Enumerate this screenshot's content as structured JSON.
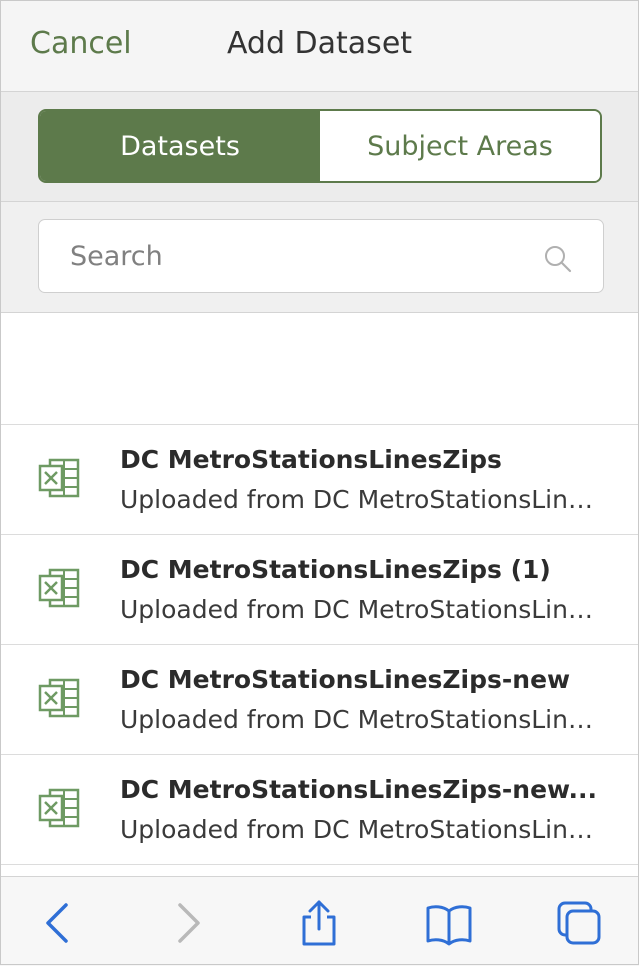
{
  "header": {
    "cancel_label": "Cancel",
    "title": "Add Dataset"
  },
  "segments": {
    "datasets_label": "Datasets",
    "subject_areas_label": "Subject Areas",
    "active": "Datasets"
  },
  "search": {
    "placeholder": "Search",
    "value": "",
    "icon": "search-icon"
  },
  "datasets": [
    {
      "name": "DC MetroStationsLinesZips",
      "description": "Uploaded from DC MetroStationsLinesZips.xlsx",
      "icon": "excel-file-icon"
    },
    {
      "name": "DC MetroStationsLinesZips (1)",
      "description": "Uploaded from DC MetroStationsLinesZips.xlsx",
      "icon": "excel-file-icon"
    },
    {
      "name": "DC MetroStationsLinesZips-new",
      "description": "Uploaded from DC MetroStationsLinesZips.xlsx",
      "icon": "excel-file-icon"
    },
    {
      "name": "DC MetroStationsLinesZips-new...",
      "description": "Uploaded from DC MetroStationsLinesZips.xlsx",
      "icon": "excel-file-icon"
    }
  ],
  "toolbar": {
    "icons": [
      "back-icon",
      "forward-icon",
      "share-icon",
      "bookmarks-icon",
      "tabs-icon"
    ]
  },
  "colors": {
    "accent": "#5d7a4b",
    "toolbar_blue": "#2f6fd6",
    "disabled": "#b9b9b9"
  }
}
